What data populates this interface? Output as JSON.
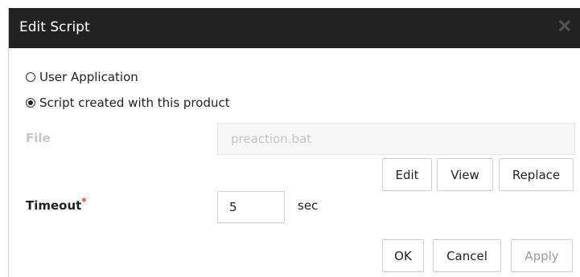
{
  "dialog": {
    "title": "Edit Script",
    "close_icon": "close-icon"
  },
  "script_source": {
    "options": [
      {
        "label": "User Application",
        "selected": false
      },
      {
        "label": "Script created with this product",
        "selected": true
      }
    ]
  },
  "file": {
    "label": "File",
    "value": "preaction.bat",
    "disabled": true
  },
  "file_actions": {
    "edit_label": "Edit",
    "view_label": "View",
    "replace_label": "Replace"
  },
  "timeout": {
    "label": "Timeout",
    "required_marker": "*",
    "value": "5",
    "unit": "sec"
  },
  "footer": {
    "ok_label": "OK",
    "cancel_label": "Cancel",
    "apply_label": "Apply"
  },
  "colors": {
    "titlebar": "#222222",
    "required": "#d04a2a",
    "disabled_text": "#c7c7c7"
  }
}
